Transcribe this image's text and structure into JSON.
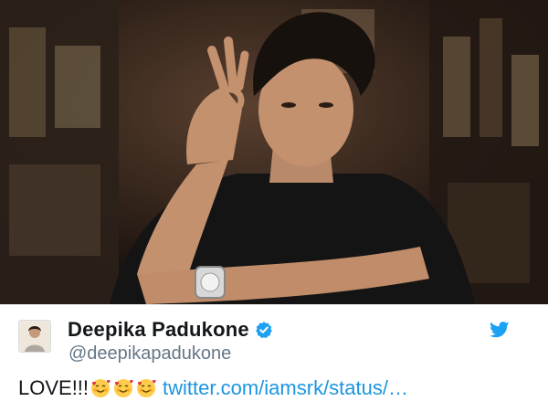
{
  "tweet_card": {
    "author_name": "Deepika Padukone",
    "handle": "@deepikapadukone",
    "text": "LOVE!!!",
    "emojis": [
      "smiling-face-with-hearts",
      "smiling-face-with-hearts",
      "smiling-face-with-hearts"
    ],
    "link": "twitter.com/iamsrk/status/…",
    "verified": true
  },
  "colors": {
    "link": "#1b95e0",
    "verified_badge": "#1da1f2",
    "twitter_bird": "#1da1f2",
    "name": "#14171a",
    "handle": "#657786"
  },
  "icons": {
    "verified": "verified-badge-icon",
    "bird": "twitter-bird-icon"
  }
}
